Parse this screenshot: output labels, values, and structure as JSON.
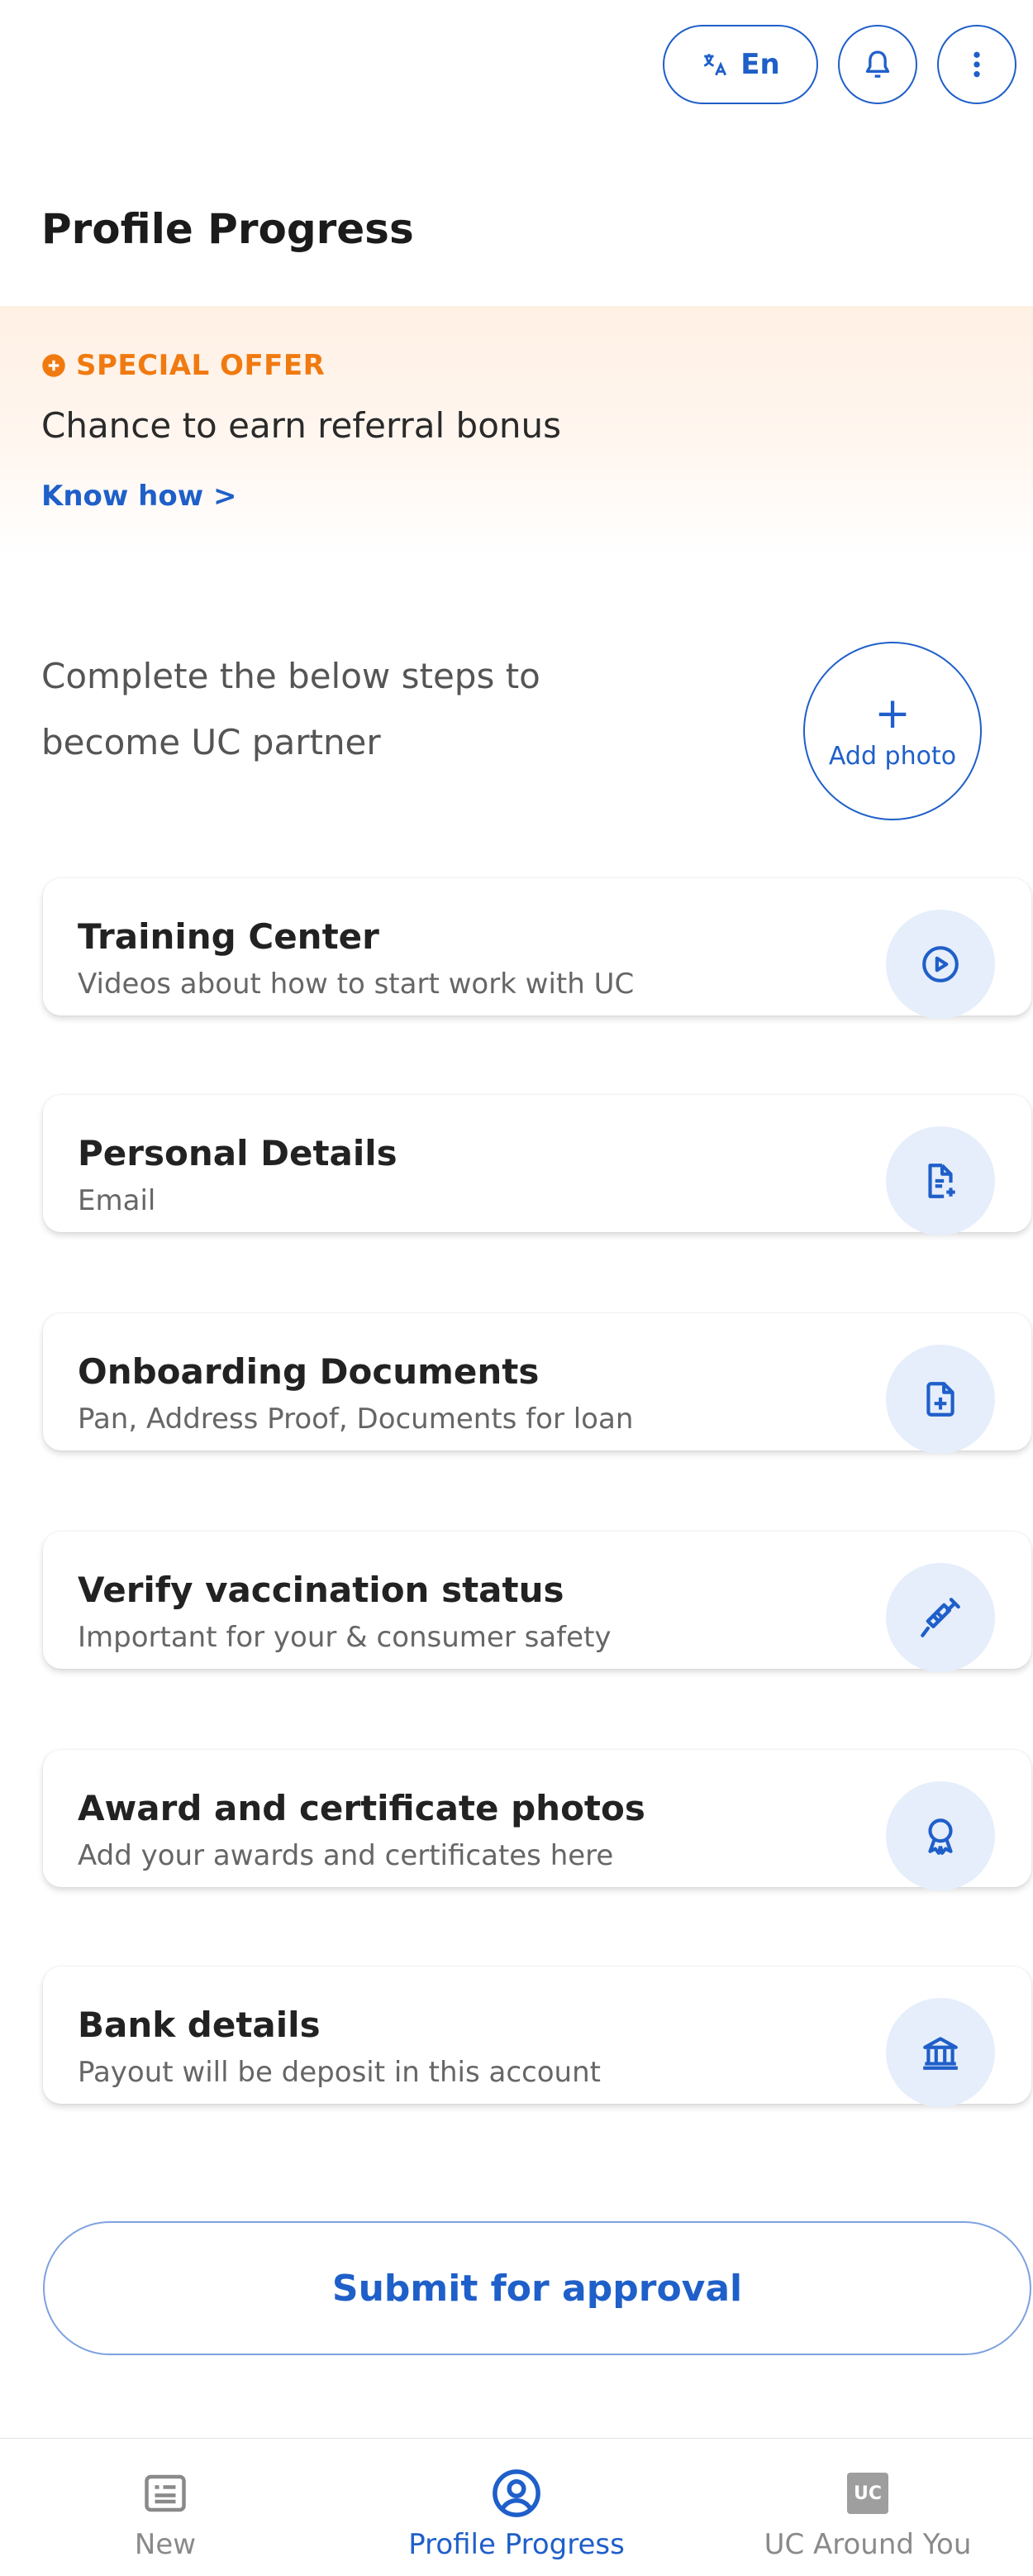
{
  "header": {
    "language_label": "En",
    "title": "Profile Progress"
  },
  "offer": {
    "tag": "SPECIAL OFFER",
    "text": "Chance to earn referral bonus",
    "link": "Know how >"
  },
  "intro": {
    "text": "Complete the below steps to become UC partner",
    "add_photo_label": "Add photo"
  },
  "steps": [
    {
      "title": "Training Center",
      "subtitle": "Videos about how to start work with UC",
      "icon": "play-circle-icon"
    },
    {
      "title": "Personal Details",
      "subtitle": "Email",
      "icon": "document-add-icon"
    },
    {
      "title": "Onboarding Documents",
      "subtitle": "Pan, Address Proof, Documents for loan",
      "icon": "file-plus-icon"
    },
    {
      "title": "Verify vaccination status",
      "subtitle": "Important for your & consumer safety",
      "icon": "syringe-icon"
    },
    {
      "title": "Award and certificate photos",
      "subtitle": "Add your awards and certificates here",
      "icon": "award-icon"
    },
    {
      "title": "Bank details",
      "subtitle": "Payout will be deposit in this account",
      "icon": "bank-icon"
    }
  ],
  "submit_label": "Submit for approval",
  "bottom_nav": [
    {
      "label": "New",
      "icon": "news-icon",
      "active": false
    },
    {
      "label": "Profile Progress",
      "icon": "profile-icon",
      "active": true
    },
    {
      "label": "UC Around You",
      "icon": "uc-logo-icon",
      "badge": "UC",
      "active": false
    }
  ],
  "colors": {
    "accent": "#1f5fc9",
    "offer_orange": "#f07a10",
    "icon_bg": "#e6eefb"
  }
}
